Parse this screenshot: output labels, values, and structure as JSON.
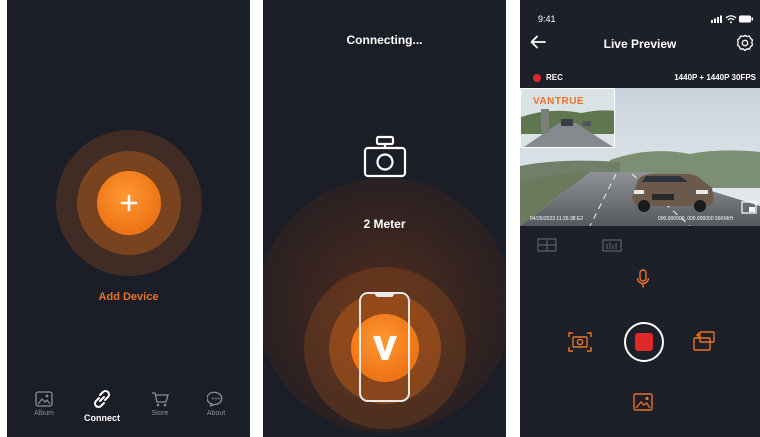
{
  "screen1": {
    "add_device_label": "Add Device",
    "tabs": [
      {
        "label": "Album",
        "icon": "album-icon"
      },
      {
        "label": "Connect",
        "icon": "link-icon",
        "active": true
      },
      {
        "label": "Store",
        "icon": "cart-icon"
      },
      {
        "label": "About",
        "icon": "chat-icon"
      }
    ]
  },
  "screen2": {
    "title": "Connecting...",
    "distance": "2 Meter",
    "icons": [
      "dashcam-icon",
      "phone-icon",
      "v-logo-icon"
    ]
  },
  "screen3": {
    "time": "9:41",
    "title": "Live Preview",
    "rec_label": "REC",
    "resolution": "1440P + 1440P 30FPS",
    "brand": "VANTRUE",
    "overlay_date": "04/25/2023  11:26:38  E2",
    "overlay_coords": "000.000000,  000.000000  56KM/H",
    "colors": {
      "accent": "#e8722a",
      "rec": "#e02a2a",
      "background": "#1d2029"
    }
  }
}
